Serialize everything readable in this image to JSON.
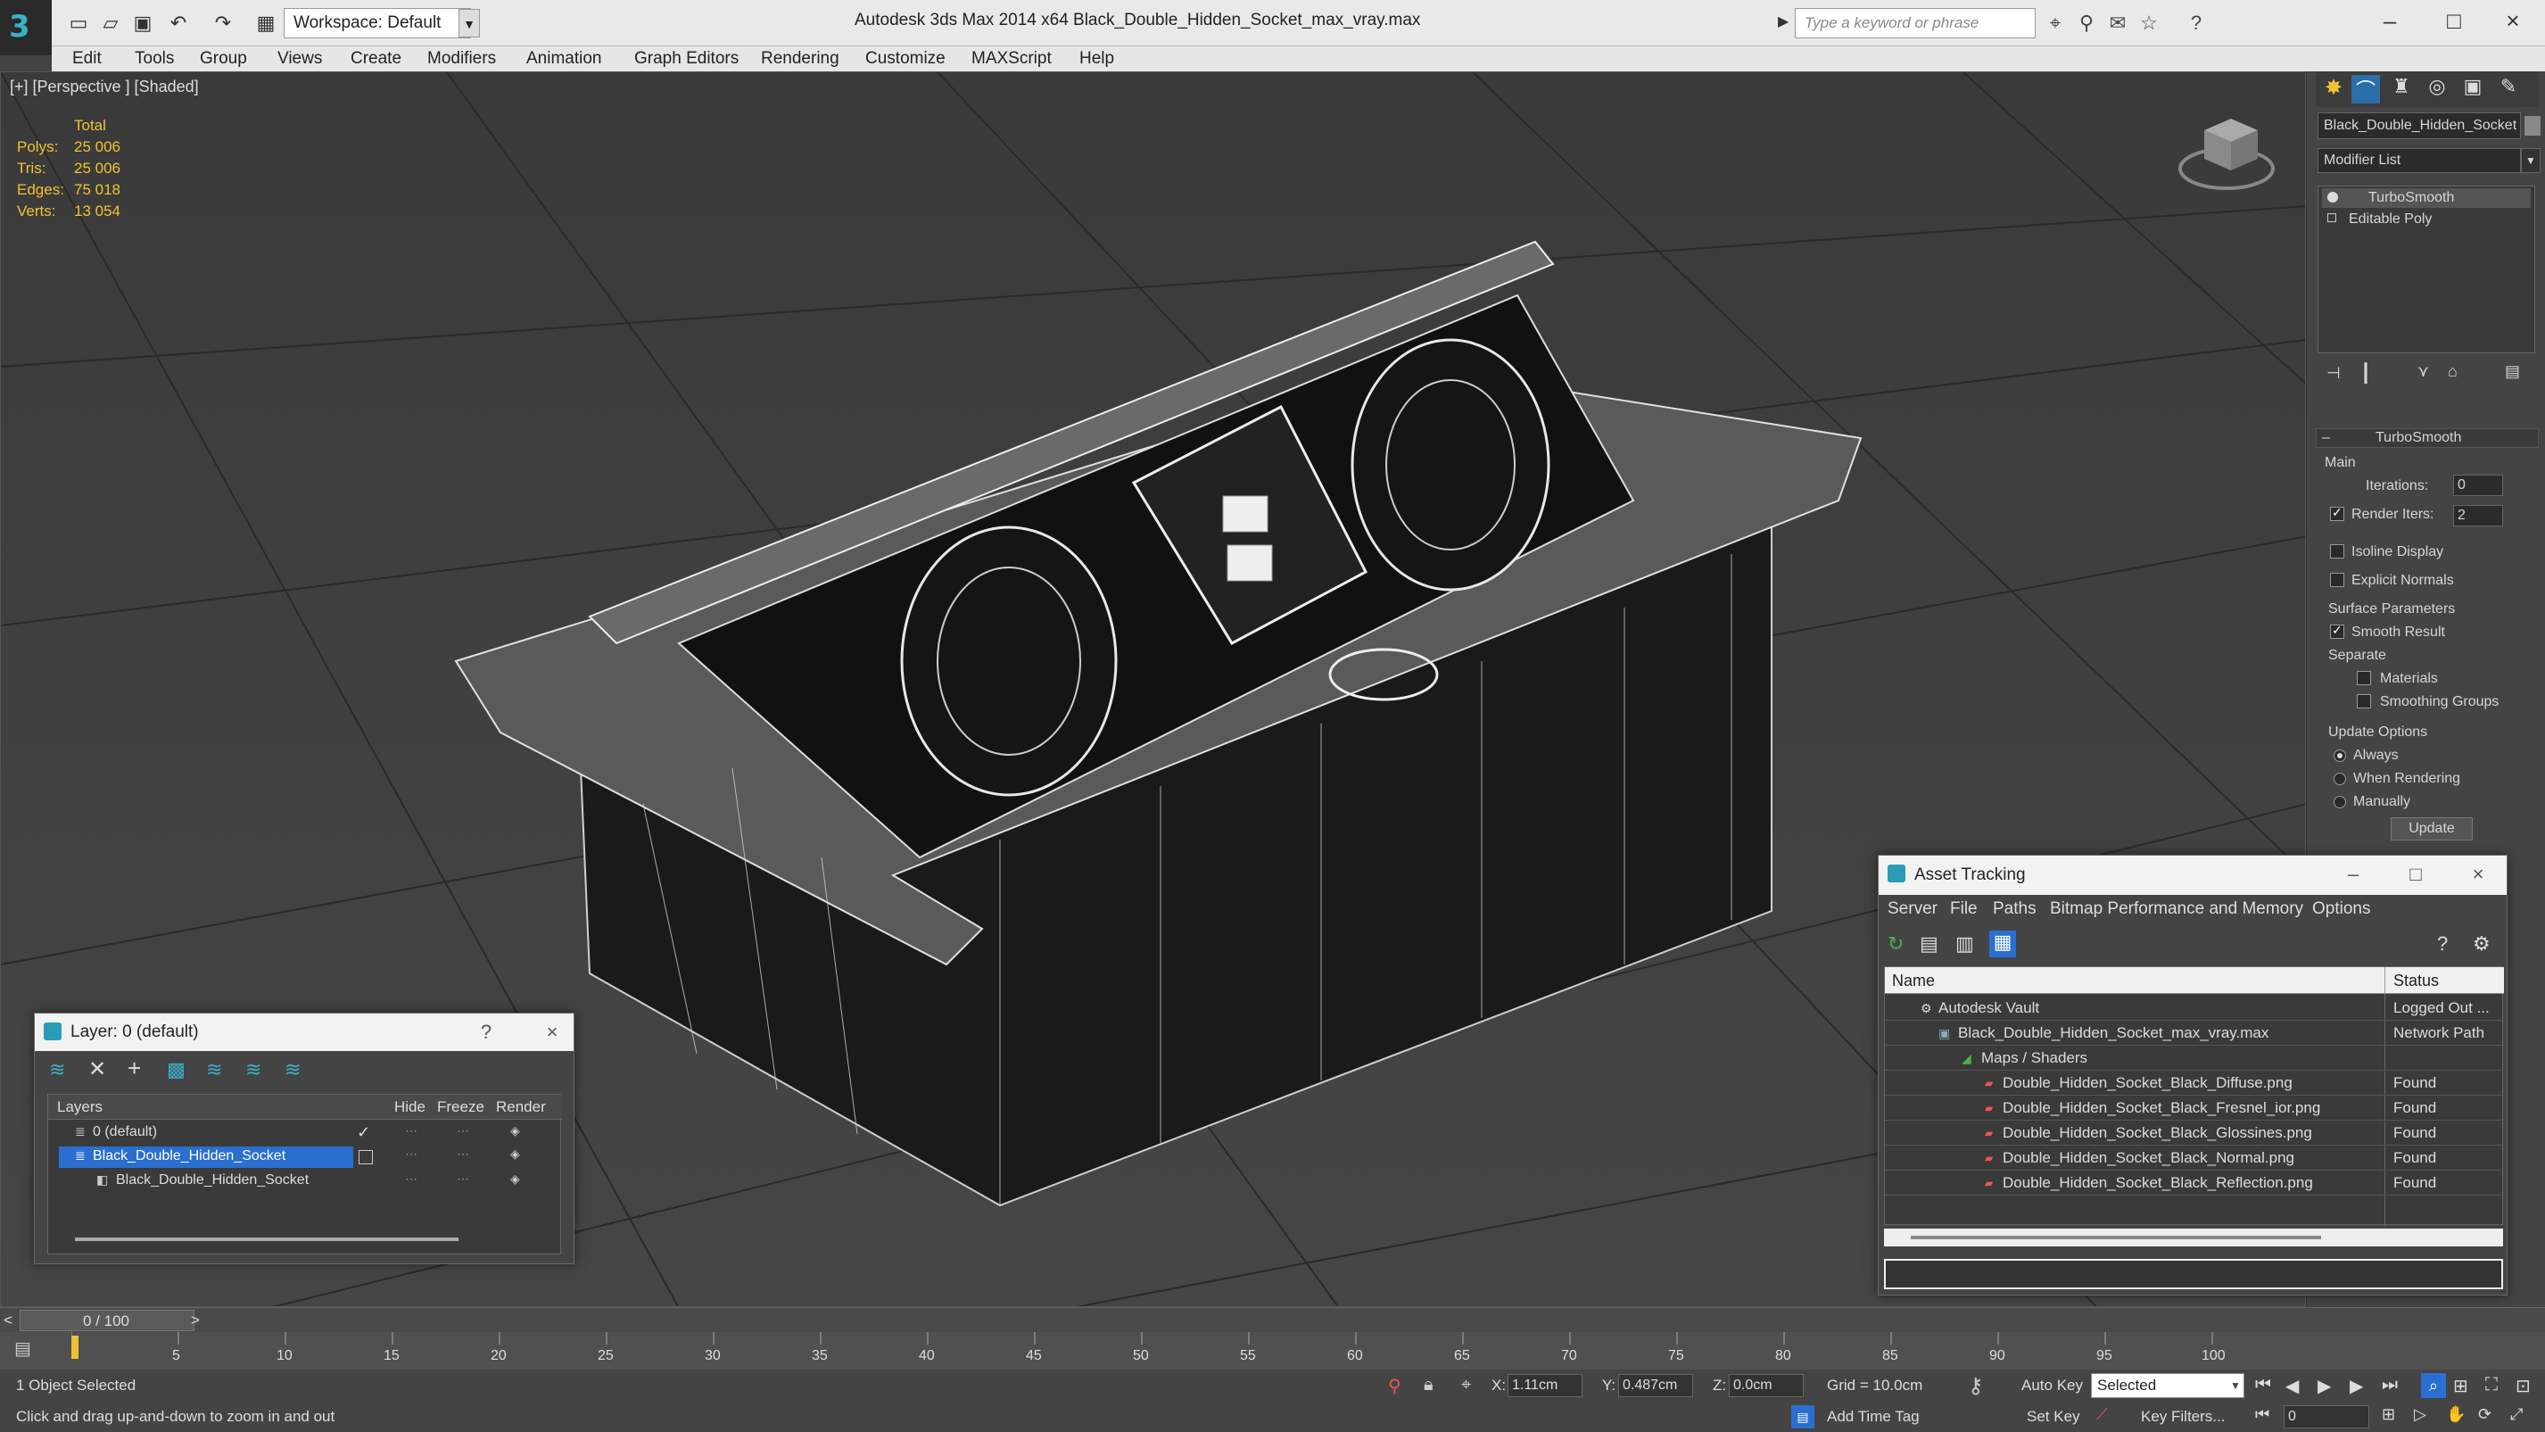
{
  "titlebar": {
    "workspace": "Workspace: Default",
    "app_title": "Autodesk 3ds Max  2014 x64      Black_Double_Hidden_Socket_max_vray.max",
    "search_placeholder": "Type a keyword or phrase"
  },
  "menubar": {
    "items": [
      "Edit",
      "Tools",
      "Group",
      "Views",
      "Create",
      "Modifiers",
      "Animation",
      "Graph Editors",
      "Rendering",
      "Customize",
      "MAXScript",
      "Help"
    ]
  },
  "viewport": {
    "label": "[+] [Perspective ] [Shaded]",
    "stats": {
      "header": "Total",
      "rows": [
        {
          "k": "Polys:",
          "v": "25 006"
        },
        {
          "k": "Tris:",
          "v": "25 006"
        },
        {
          "k": "Edges:",
          "v": "75 018"
        },
        {
          "k": "Verts:",
          "v": "13 054"
        }
      ]
    }
  },
  "command_panel": {
    "object_name": "Black_Double_Hidden_Socket",
    "modifier_list": "Modifier List",
    "stack": [
      "TurboSmooth",
      "Editable Poly"
    ],
    "rollout_title": "TurboSmooth",
    "main_label": "Main",
    "iterations_label": "Iterations:",
    "iterations_value": "0",
    "render_iters_label": "Render Iters:",
    "render_iters_value": "2",
    "isoline": "Isoline Display",
    "explicit_normals": "Explicit Normals",
    "surface_params": "Surface Parameters",
    "smooth_result": "Smooth Result",
    "separate": "Separate",
    "materials": "Materials",
    "smoothing_groups": "Smoothing Groups",
    "update_options": "Update Options",
    "always": "Always",
    "when_rendering": "When Rendering",
    "manually": "Manually",
    "update_button": "Update"
  },
  "layer_dialog": {
    "title": "Layer: 0 (default)",
    "help": "?",
    "close": "×",
    "columns": [
      "Layers",
      "Hide",
      "Freeze",
      "Render"
    ],
    "rows": [
      {
        "name": "0 (default)"
      },
      {
        "name": "Black_Double_Hidden_Socket"
      },
      {
        "name": "Black_Double_Hidden_Socket"
      }
    ],
    "checkmark": "✓"
  },
  "asset_tracking": {
    "title": "Asset Tracking",
    "menu": [
      "Server",
      "File",
      "Paths",
      "Bitmap Performance and Memory",
      "Options"
    ],
    "columns": [
      "Name",
      "Status"
    ],
    "rows": [
      {
        "name": "Autodesk Vault",
        "status": "Logged Out ..."
      },
      {
        "name": "Black_Double_Hidden_Socket_max_vray.max",
        "status": "Network Path"
      },
      {
        "name": "Maps / Shaders",
        "status": ""
      },
      {
        "name": "Double_Hidden_Socket_Black_Diffuse.png",
        "status": "Found"
      },
      {
        "name": "Double_Hidden_Socket_Black_Fresnel_ior.png",
        "status": "Found"
      },
      {
        "name": "Double_Hidden_Socket_Black_Glossines.png",
        "status": "Found"
      },
      {
        "name": "Double_Hidden_Socket_Black_Normal.png",
        "status": "Found"
      },
      {
        "name": "Double_Hidden_Socket_Black_Reflection.png",
        "status": "Found"
      }
    ]
  },
  "timeline": {
    "frame": "0 / 100",
    "ticks": [
      "5",
      "10",
      "15",
      "20",
      "25",
      "30",
      "35",
      "40",
      "45",
      "50",
      "55",
      "60",
      "65",
      "70",
      "75",
      "80",
      "85",
      "90",
      "95",
      "100"
    ],
    "prev": "<",
    "next": ">"
  },
  "status": {
    "selected": "1 Object Selected",
    "hint": "Click and drag up-and-down to zoom in and out",
    "x_label": "X:",
    "x_value": "1.11cm",
    "y_label": "Y:",
    "y_value": "0.487cm",
    "z_label": "Z:",
    "z_value": "0.0cm",
    "grid": "Grid = 10.0cm",
    "auto_key": "Auto Key",
    "selected_dropdown": "Selected",
    "set_key": "Set Key",
    "key_filters": "Key Filters...",
    "add_time_tag": "Add Time Tag",
    "frame_value": "0"
  }
}
